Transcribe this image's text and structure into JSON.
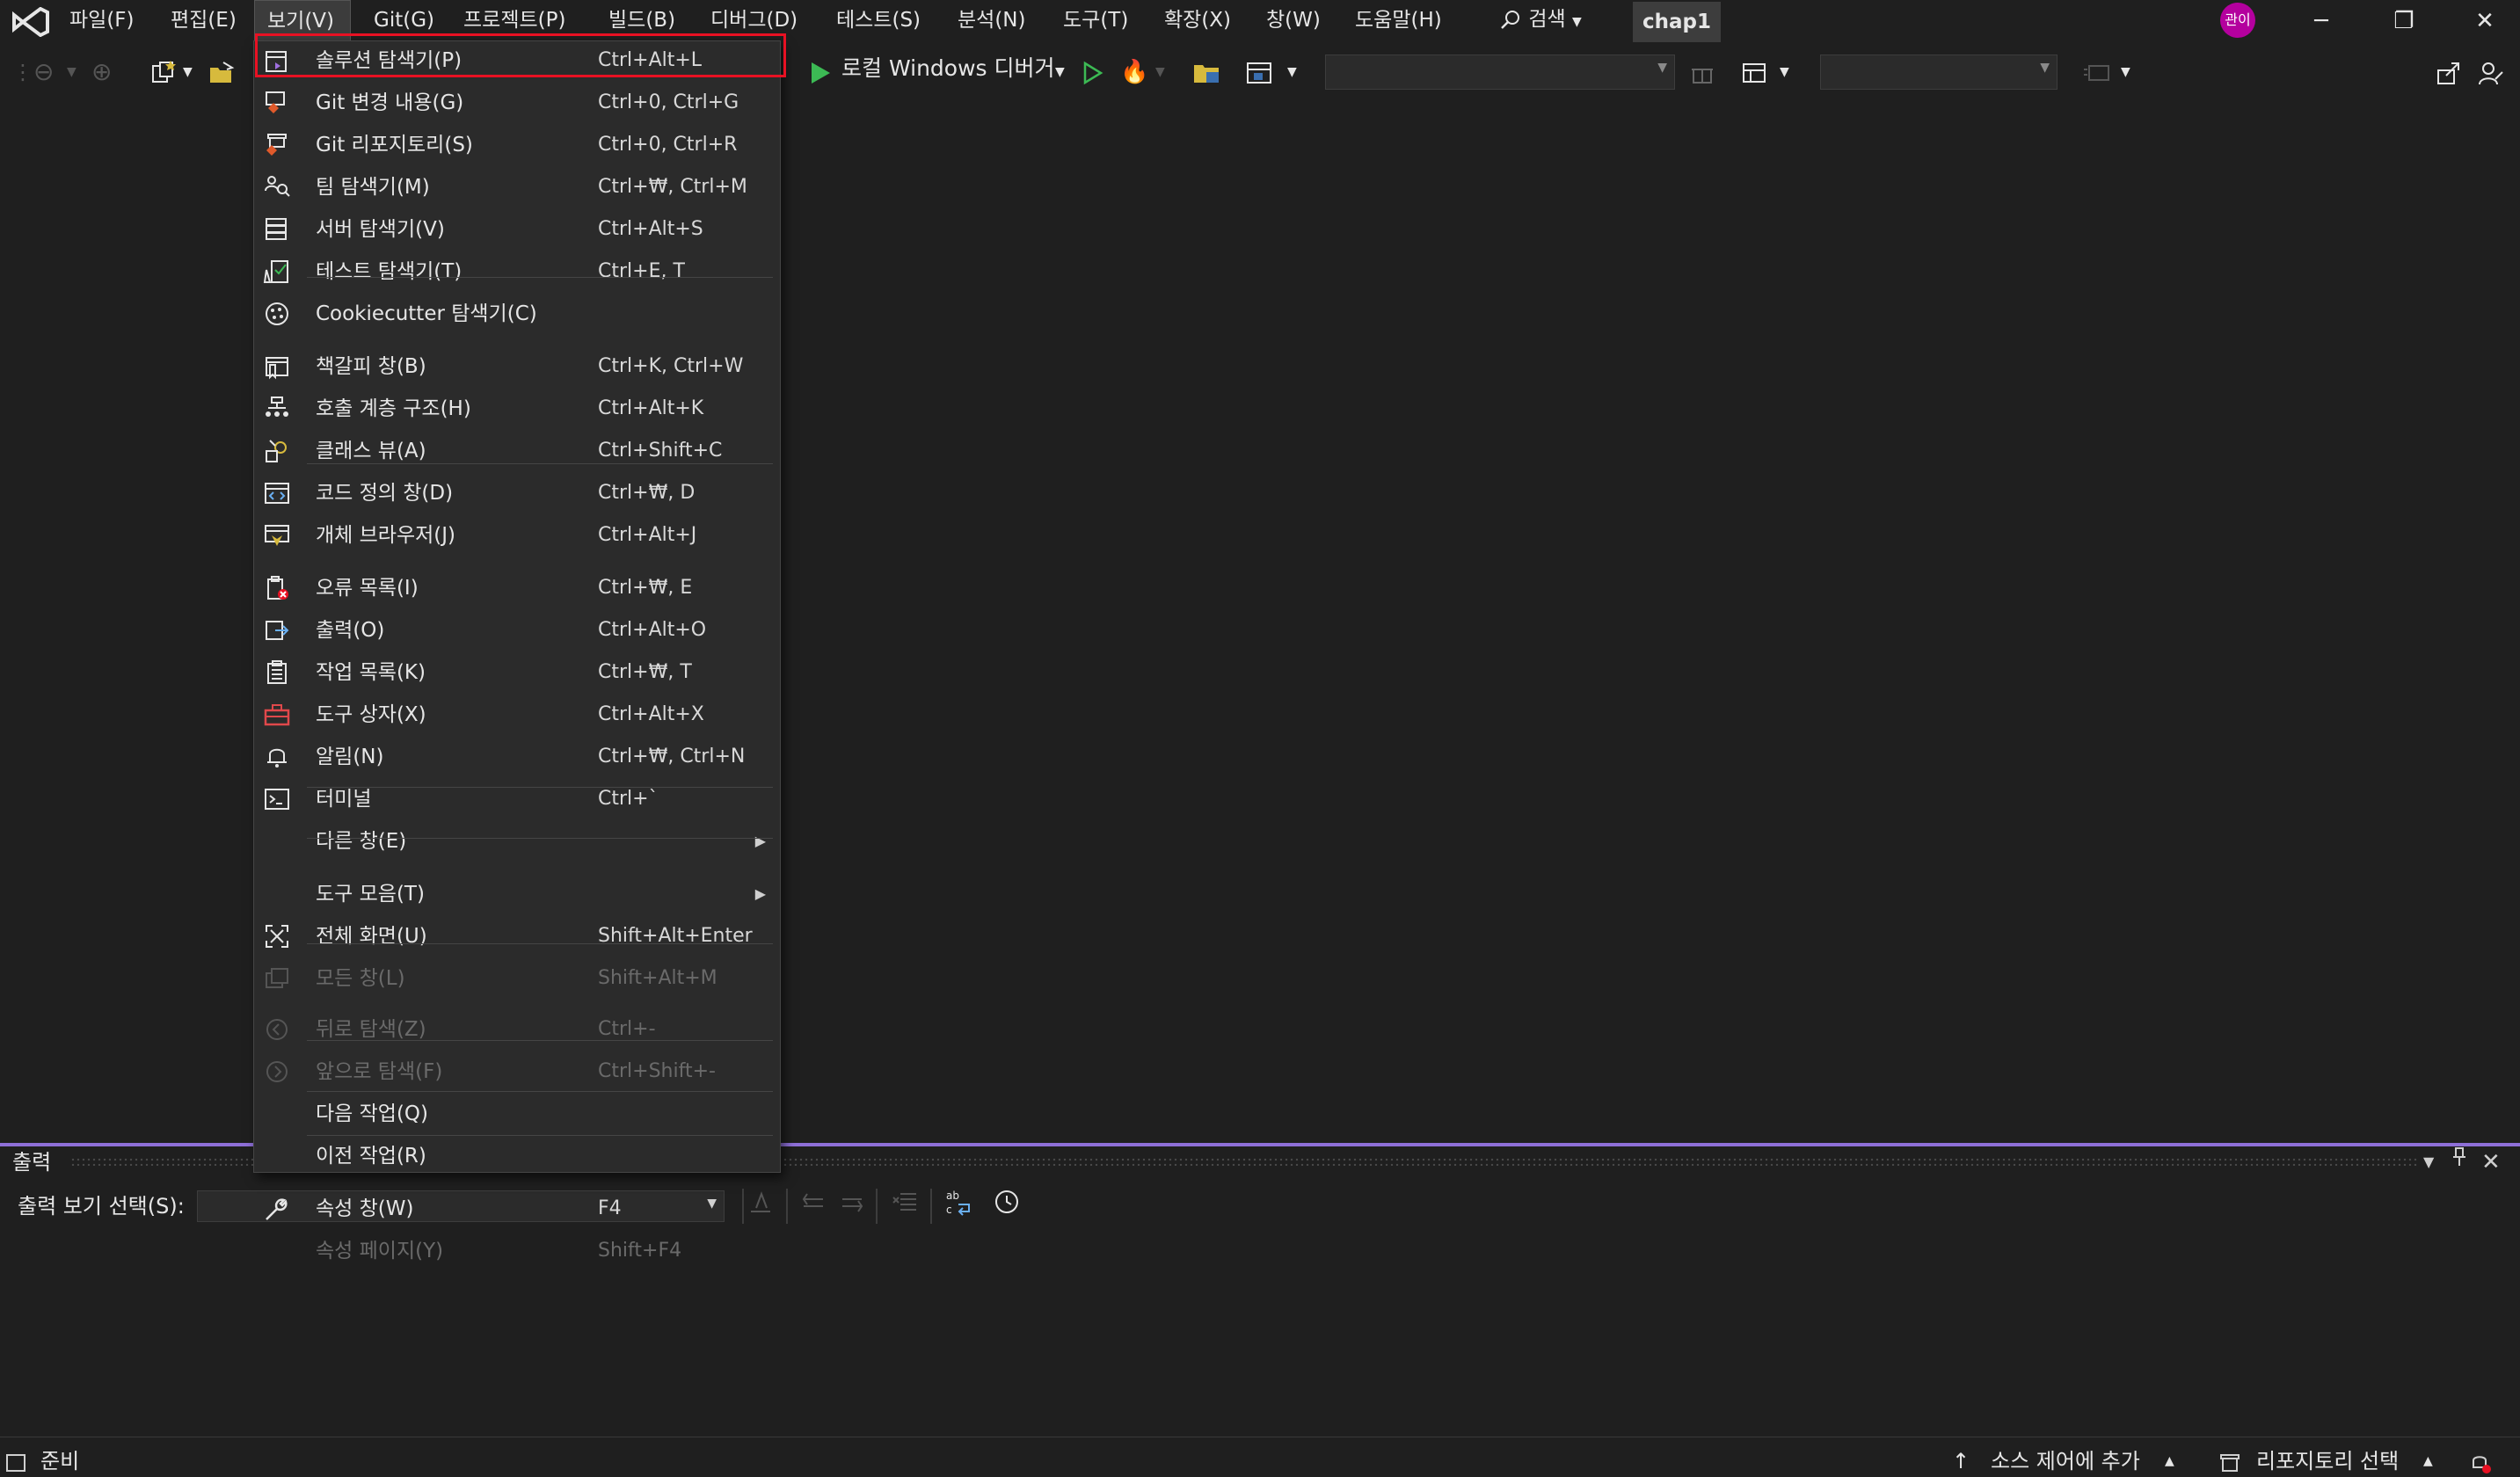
{
  "menubar": {
    "items": [
      {
        "label": "파일(F)"
      },
      {
        "label": "편집(E)"
      },
      {
        "label": "보기(V)"
      },
      {
        "label": "Git(G)"
      },
      {
        "label": "프로젝트(P)"
      },
      {
        "label": "빌드(B)"
      },
      {
        "label": "디버그(D)"
      },
      {
        "label": "테스트(S)"
      },
      {
        "label": "분석(N)"
      },
      {
        "label": "도구(T)"
      },
      {
        "label": "확장(X)"
      },
      {
        "label": "창(W)"
      },
      {
        "label": "도움말(H)"
      }
    ],
    "search_label": "검색",
    "solution_name": "chap1",
    "avatar_initials": "관이"
  },
  "toolbar": {
    "debugger_label": "로컬 Windows 디버거"
  },
  "view_menu": {
    "items": [
      {
        "label": "솔루션 탐색기(P)",
        "shortcut": "Ctrl+Alt+L",
        "icon": "solution-explorer-icon",
        "enabled": true
      },
      {
        "label": "Git 변경 내용(G)",
        "shortcut": "Ctrl+0, Ctrl+G",
        "icon": "git-changes-icon",
        "enabled": true
      },
      {
        "label": "Git 리포지토리(S)",
        "shortcut": "Ctrl+0, Ctrl+R",
        "icon": "git-repository-icon",
        "enabled": true
      },
      {
        "label": "팀 탐색기(M)",
        "shortcut": "Ctrl+₩, Ctrl+M",
        "icon": "team-explorer-icon",
        "enabled": true
      },
      {
        "label": "서버 탐색기(V)",
        "shortcut": "Ctrl+Alt+S",
        "icon": "server-explorer-icon",
        "enabled": true
      },
      {
        "label": "테스트 탐색기(T)",
        "shortcut": "Ctrl+E, T",
        "icon": "test-explorer-icon",
        "enabled": true
      },
      {
        "label": "Cookiecutter 탐색기(C)",
        "shortcut": "",
        "icon": "cookiecutter-icon",
        "enabled": true
      },
      {
        "label": "책갈피 창(B)",
        "shortcut": "Ctrl+K, Ctrl+W",
        "icon": "bookmark-icon",
        "enabled": true
      },
      {
        "label": "호출 계층 구조(H)",
        "shortcut": "Ctrl+Alt+K",
        "icon": "call-hierarchy-icon",
        "enabled": true
      },
      {
        "label": "클래스 뷰(A)",
        "shortcut": "Ctrl+Shift+C",
        "icon": "class-view-icon",
        "enabled": true
      },
      {
        "label": "코드 정의 창(D)",
        "shortcut": "Ctrl+₩, D",
        "icon": "code-definition-icon",
        "enabled": true
      },
      {
        "label": "개체 브라우저(J)",
        "shortcut": "Ctrl+Alt+J",
        "icon": "object-browser-icon",
        "enabled": true
      },
      {
        "label": "오류 목록(I)",
        "shortcut": "Ctrl+₩, E",
        "icon": "error-list-icon",
        "enabled": true
      },
      {
        "label": "출력(O)",
        "shortcut": "Ctrl+Alt+O",
        "icon": "output-icon",
        "enabled": true
      },
      {
        "label": "작업 목록(K)",
        "shortcut": "Ctrl+₩, T",
        "icon": "task-list-icon",
        "enabled": true
      },
      {
        "label": "도구 상자(X)",
        "shortcut": "Ctrl+Alt+X",
        "icon": "toolbox-icon",
        "enabled": true
      },
      {
        "label": "알림(N)",
        "shortcut": "Ctrl+₩, Ctrl+N",
        "icon": "notification-bell-icon",
        "enabled": true
      },
      {
        "label": "터미널",
        "shortcut": "Ctrl+`",
        "icon": "terminal-icon",
        "enabled": true
      },
      {
        "label": "다른 창(E)",
        "shortcut": "",
        "icon": "",
        "enabled": true,
        "submenu": true
      },
      {
        "label": "도구 모음(T)",
        "shortcut": "",
        "icon": "",
        "enabled": true,
        "submenu": true
      },
      {
        "label": "전체 화면(U)",
        "shortcut": "Shift+Alt+Enter",
        "icon": "full-screen-icon",
        "enabled": true
      },
      {
        "label": "모든 창(L)",
        "shortcut": "Shift+Alt+M",
        "icon": "all-windows-icon",
        "enabled": false
      },
      {
        "label": "뒤로 탐색(Z)",
        "shortcut": "Ctrl+-",
        "icon": "navigate-back-icon",
        "enabled": false
      },
      {
        "label": "앞으로 탐색(F)",
        "shortcut": "Ctrl+Shift+-",
        "icon": "navigate-forward-icon",
        "enabled": false
      },
      {
        "label": "다음 작업(Q)",
        "shortcut": "",
        "icon": "",
        "enabled": true
      },
      {
        "label": "이전 작업(R)",
        "shortcut": "",
        "icon": "",
        "enabled": true
      },
      {
        "label": "속성 창(W)",
        "shortcut": "F4",
        "icon": "wrench-icon",
        "enabled": true
      },
      {
        "label": "속성 페이지(Y)",
        "shortcut": "Shift+F4",
        "icon": "",
        "enabled": false
      }
    ]
  },
  "output_panel": {
    "title": "출력",
    "select_label": "출력 보기 선택(S):",
    "select_value": ""
  },
  "status_bar": {
    "ready": "준비",
    "source_control": "소스 제어에 추가",
    "repository": "리포지토리 선택"
  },
  "colors": {
    "accent": "#8e6fd8",
    "highlight_box": "#e81123",
    "run_green": "#3cba54",
    "avatar": "#b4009e"
  }
}
